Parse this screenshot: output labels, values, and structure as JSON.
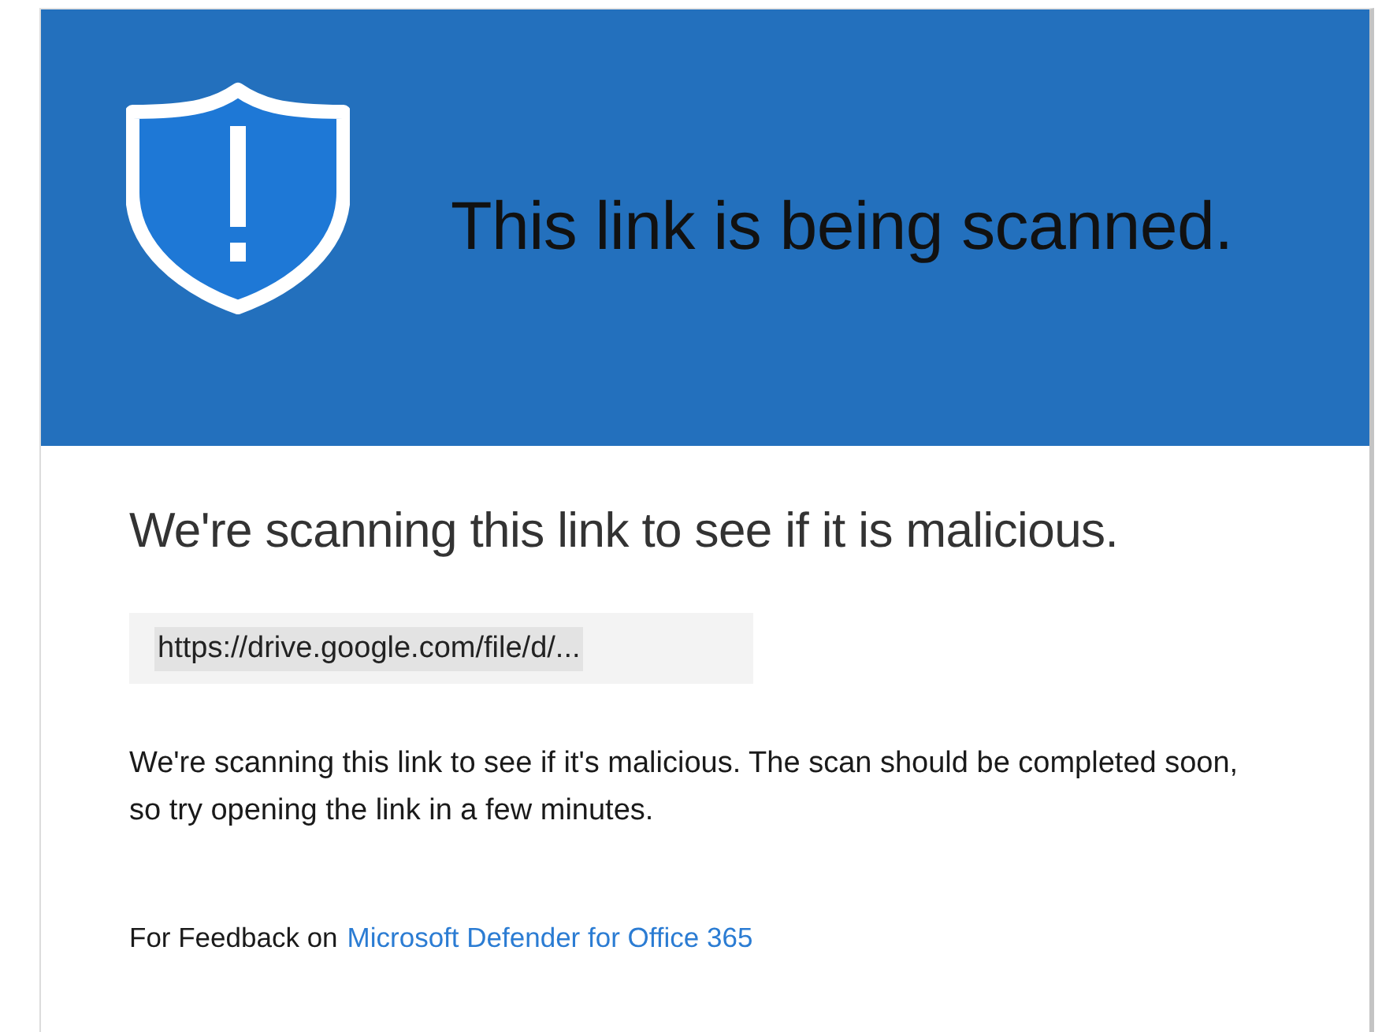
{
  "header": {
    "title": "This link is being scanned."
  },
  "heading": "We're scanning this link to see if it is malicious.",
  "url": "https://drive.google.com/file/d/...",
  "description": "We're scanning this link to see if it's malicious. The scan should be completed soon, so try opening the link in a few minutes.",
  "footer": {
    "text": "For Feedback on",
    "link": "Microsoft Defender for Office 365"
  }
}
